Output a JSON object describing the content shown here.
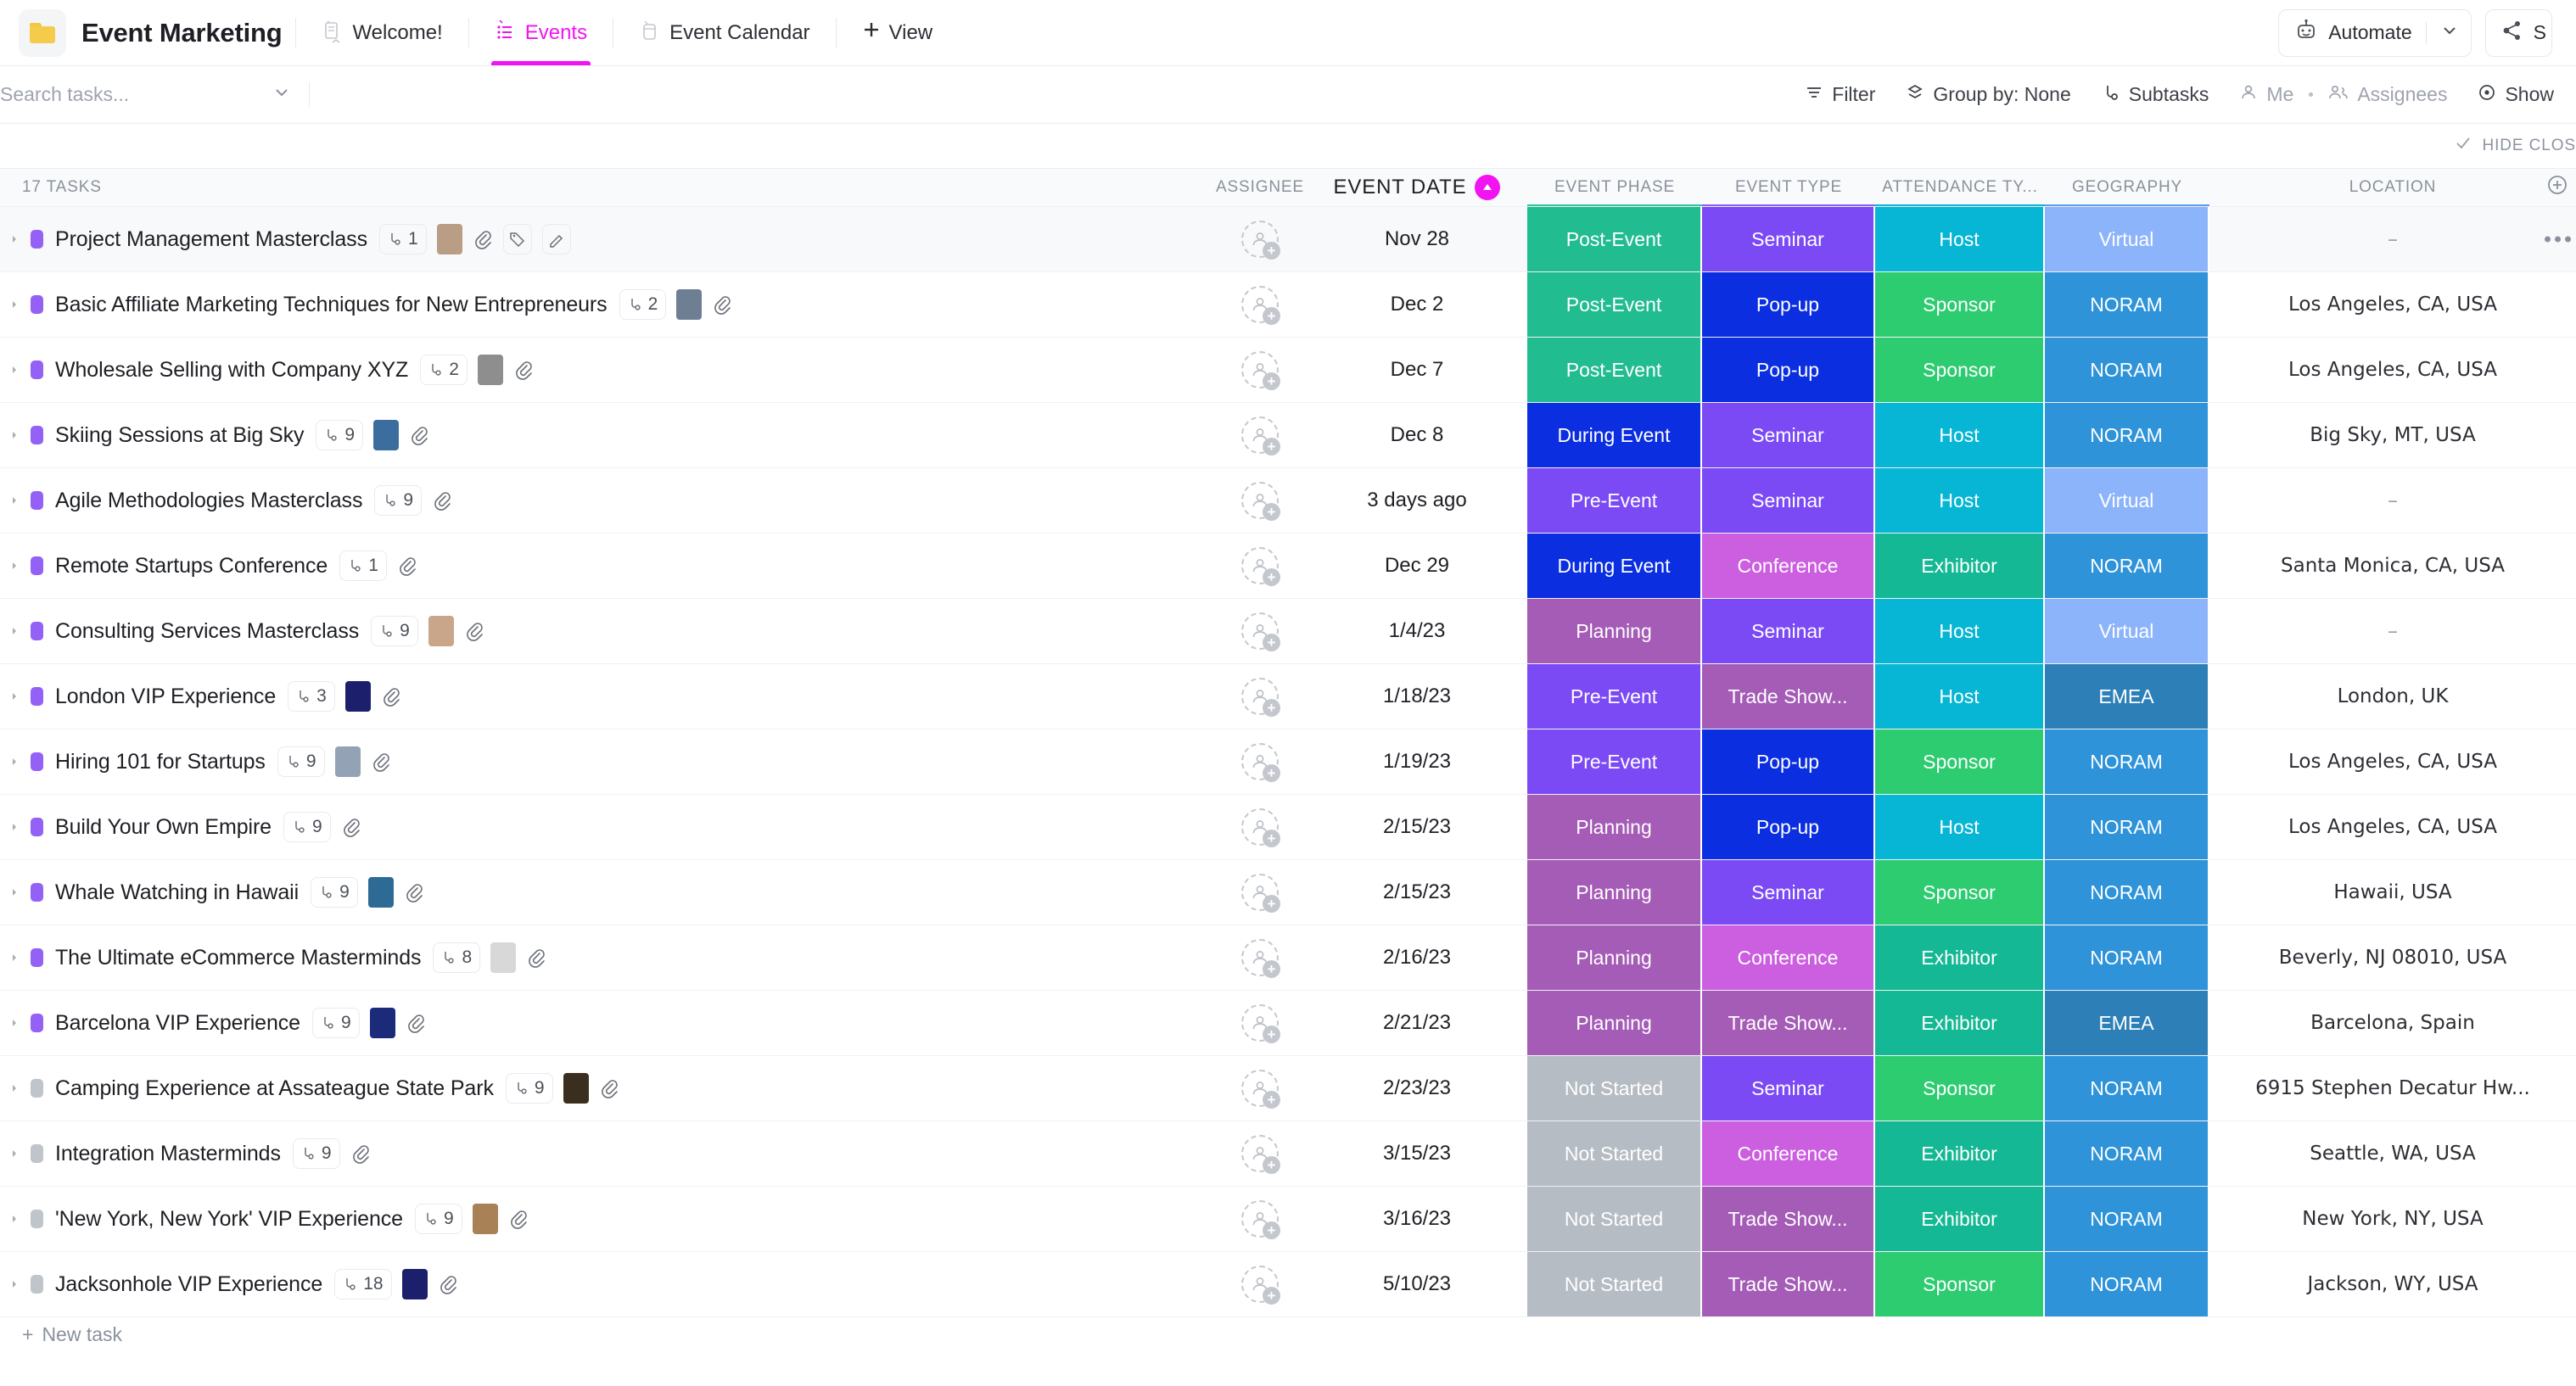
{
  "header": {
    "folder_icon": "folder-icon",
    "workspace_title": "Event Marketing",
    "tabs": [
      {
        "label": "Welcome!",
        "icon": "doc-home-icon",
        "active": false
      },
      {
        "label": "Events",
        "icon": "list-icon",
        "active": true
      },
      {
        "label": "Event Calendar",
        "icon": "calendar-icon",
        "active": false
      }
    ],
    "add_view_label": "View",
    "add_view_icon": "plus-icon",
    "automate_label": "Automate",
    "automate_icon": "robot-icon",
    "automate_caret_icon": "chevron-down-icon",
    "share_label": "S",
    "share_icon": "share-icon",
    "accent_color": "#f213f2"
  },
  "toolbar": {
    "search_placeholder": "Search tasks...",
    "search_value": "",
    "search_caret_icon": "chevron-down-icon",
    "items": [
      {
        "label": "Filter",
        "icon": "filter-icon",
        "muted": false
      },
      {
        "label": "Group by: None",
        "icon": "group-icon",
        "muted": false
      },
      {
        "label": "Subtasks",
        "icon": "subtask-icon",
        "muted": false
      },
      {
        "label": "Me",
        "icon": "person-icon",
        "muted": true
      },
      {
        "label": "Assignees",
        "icon": "people-icon",
        "muted": true
      },
      {
        "label": "Show",
        "icon": "eye-icon",
        "muted": false
      }
    ]
  },
  "strip": {
    "hide_closed_label": "HIDE CLOS",
    "hide_closed_icon": "check-icon"
  },
  "table": {
    "columns": [
      {
        "label": "17 TASKS",
        "name": "tasks-count",
        "underline": ""
      },
      {
        "label": "ASSIGNEE",
        "name": "assignee",
        "underline": ""
      },
      {
        "label": "EVENT DATE",
        "name": "event-date",
        "underline": "",
        "sorted": true,
        "sort_icon": "sort-asc-icon"
      },
      {
        "label": "EVENT PHASE",
        "name": "event-phase",
        "underline": "#2ec4a0"
      },
      {
        "label": "EVENT TYPE",
        "name": "event-type",
        "underline": "#8b5cf6"
      },
      {
        "label": "ATTENDANCE TY...",
        "name": "attendance-type",
        "underline": "#06b6d4"
      },
      {
        "label": "GEOGRAPHY",
        "name": "geography",
        "underline": "#5b9bf0"
      },
      {
        "label": "LOCATION",
        "name": "location",
        "underline": ""
      }
    ],
    "add_column_icon": "plus-circle-icon",
    "new_task_label": "New task",
    "new_task_icon": "plus-icon",
    "status_colors": {
      "open": "#9461f7",
      "not_started": "#c0c5cc"
    },
    "tag_colors": {
      "Post-Event": "#22bc91",
      "During Event": "#0a2ee0",
      "Pre-Event": "#7b4af5",
      "Planning": "#a45cb6",
      "Not Started": "#b6bcc4",
      "Seminar": "#7b4af5",
      "Pop-up": "#0a2ee0",
      "Conference": "#cc5fe0",
      "Trade Show...": "#a45cb6",
      "Host": "#06b6d4",
      "Sponsor": "#2ecc71",
      "Exhibitor": "#15b894",
      "Virtual": "#8cb4fa",
      "NORAM": "#2e93d9",
      "EMEA": "#2d7fb8"
    },
    "rows": [
      {
        "title": "Project Management Masterclass",
        "status": "open",
        "subtasks": "1",
        "thumb": "#b99d85",
        "has_thumb": true,
        "extra_icons": [
          "paperclip-icon",
          "tag-icon",
          "pencil-icon"
        ],
        "date": "Nov 28",
        "phase": "Post-Event",
        "type": "Seminar",
        "attendance": "Host",
        "geography": "Virtual",
        "location": "–",
        "location_empty": true,
        "hovered": true
      },
      {
        "title": "Basic Affiliate Marketing Techniques for New Entrepreneurs",
        "status": "open",
        "subtasks": "2",
        "thumb": "#6e7f94",
        "has_thumb": true,
        "extra_icons": [
          "paperclip-icon"
        ],
        "date": "Dec 2",
        "phase": "Post-Event",
        "type": "Pop-up",
        "attendance": "Sponsor",
        "geography": "NORAM",
        "location": "Los Angeles, CA, USA",
        "location_empty": false,
        "hovered": false
      },
      {
        "title": "Wholesale Selling with Company XYZ",
        "status": "open",
        "subtasks": "2",
        "thumb": "#8e8e8e",
        "has_thumb": true,
        "extra_icons": [
          "paperclip-icon"
        ],
        "date": "Dec 7",
        "phase": "Post-Event",
        "type": "Pop-up",
        "attendance": "Sponsor",
        "geography": "NORAM",
        "location": "Los Angeles, CA, USA",
        "location_empty": false,
        "hovered": false
      },
      {
        "title": "Skiing Sessions at Big Sky",
        "status": "open",
        "subtasks": "9",
        "thumb": "#3b6e9e",
        "has_thumb": true,
        "extra_icons": [
          "paperclip-icon"
        ],
        "date": "Dec 8",
        "phase": "During Event",
        "type": "Seminar",
        "attendance": "Host",
        "geography": "NORAM",
        "location": "Big Sky, MT, USA",
        "location_empty": false,
        "hovered": false
      },
      {
        "title": "Agile Methodologies Masterclass",
        "status": "open",
        "subtasks": "9",
        "thumb": "",
        "has_thumb": false,
        "extra_icons": [
          "paperclip-icon"
        ],
        "date": "3 days ago",
        "phase": "Pre-Event",
        "type": "Seminar",
        "attendance": "Host",
        "geography": "Virtual",
        "location": "–",
        "location_empty": true,
        "hovered": false
      },
      {
        "title": "Remote Startups Conference",
        "status": "open",
        "subtasks": "1",
        "thumb": "",
        "has_thumb": false,
        "extra_icons": [
          "paperclip-icon"
        ],
        "date": "Dec 29",
        "phase": "During Event",
        "type": "Conference",
        "attendance": "Exhibitor",
        "geography": "NORAM",
        "location": "Santa Monica, CA, USA",
        "location_empty": false,
        "hovered": false
      },
      {
        "title": "Consulting Services Masterclass",
        "status": "open",
        "subtasks": "9",
        "thumb": "#c9a68a",
        "has_thumb": true,
        "extra_icons": [
          "paperclip-icon"
        ],
        "date": "1/4/23",
        "phase": "Planning",
        "type": "Seminar",
        "attendance": "Host",
        "geography": "Virtual",
        "location": "–",
        "location_empty": true,
        "hovered": false
      },
      {
        "title": "London VIP Experience",
        "status": "open",
        "subtasks": "3",
        "thumb": "#1c1f6b",
        "has_thumb": true,
        "extra_icons": [
          "paperclip-icon"
        ],
        "date": "1/18/23",
        "phase": "Pre-Event",
        "type": "Trade Show...",
        "attendance": "Host",
        "geography": "EMEA",
        "location": "London, UK",
        "location_empty": false,
        "hovered": false
      },
      {
        "title": "Hiring 101 for Startups",
        "status": "open",
        "subtasks": "9",
        "thumb": "#93a3b5",
        "has_thumb": true,
        "extra_icons": [
          "paperclip-icon"
        ],
        "date": "1/19/23",
        "phase": "Pre-Event",
        "type": "Pop-up",
        "attendance": "Sponsor",
        "geography": "NORAM",
        "location": "Los Angeles, CA, USA",
        "location_empty": false,
        "hovered": false
      },
      {
        "title": "Build Your Own Empire",
        "status": "open",
        "subtasks": "9",
        "thumb": "",
        "has_thumb": false,
        "extra_icons": [
          "paperclip-icon"
        ],
        "date": "2/15/23",
        "phase": "Planning",
        "type": "Pop-up",
        "attendance": "Host",
        "geography": "NORAM",
        "location": "Los Angeles, CA, USA",
        "location_empty": false,
        "hovered": false
      },
      {
        "title": "Whale Watching in Hawaii",
        "status": "open",
        "subtasks": "9",
        "thumb": "#2d6a94",
        "has_thumb": true,
        "extra_icons": [
          "paperclip-icon"
        ],
        "date": "2/15/23",
        "phase": "Planning",
        "type": "Seminar",
        "attendance": "Sponsor",
        "geography": "NORAM",
        "location": "Hawaii, USA",
        "location_empty": false,
        "hovered": false
      },
      {
        "title": "The Ultimate eCommerce Masterminds",
        "status": "open",
        "subtasks": "8",
        "thumb": "#d8d8d8",
        "has_thumb": true,
        "extra_icons": [
          "paperclip-icon"
        ],
        "date": "2/16/23",
        "phase": "Planning",
        "type": "Conference",
        "attendance": "Exhibitor",
        "geography": "NORAM",
        "location": "Beverly, NJ 08010, USA",
        "location_empty": false,
        "hovered": false
      },
      {
        "title": "Barcelona VIP Experience",
        "status": "open",
        "subtasks": "9",
        "thumb": "#1c2a7a",
        "has_thumb": true,
        "extra_icons": [
          "paperclip-icon"
        ],
        "date": "2/21/23",
        "phase": "Planning",
        "type": "Trade Show...",
        "attendance": "Exhibitor",
        "geography": "EMEA",
        "location": "Barcelona, Spain",
        "location_empty": false,
        "hovered": false
      },
      {
        "title": "Camping Experience at Assateague State Park",
        "status": "not_started",
        "subtasks": "9",
        "thumb": "#3a2f1e",
        "has_thumb": true,
        "extra_icons": [
          "paperclip-icon"
        ],
        "date": "2/23/23",
        "phase": "Not Started",
        "type": "Seminar",
        "attendance": "Sponsor",
        "geography": "NORAM",
        "location": "6915 Stephen Decatur Hw...",
        "location_empty": false,
        "hovered": false
      },
      {
        "title": "Integration Masterminds",
        "status": "not_started",
        "subtasks": "9",
        "thumb": "",
        "has_thumb": false,
        "extra_icons": [
          "paperclip-icon"
        ],
        "date": "3/15/23",
        "phase": "Not Started",
        "type": "Conference",
        "attendance": "Exhibitor",
        "geography": "NORAM",
        "location": "Seattle, WA, USA",
        "location_empty": false,
        "hovered": false
      },
      {
        "title": "'New York, New York' VIP Experience",
        "status": "not_started",
        "subtasks": "9",
        "thumb": "#a98157",
        "has_thumb": true,
        "extra_icons": [
          "paperclip-icon"
        ],
        "date": "3/16/23",
        "phase": "Not Started",
        "type": "Trade Show...",
        "attendance": "Exhibitor",
        "geography": "NORAM",
        "location": "New York, NY, USA",
        "location_empty": false,
        "hovered": false
      },
      {
        "title": "Jacksonhole VIP Experience",
        "status": "not_started",
        "subtasks": "18",
        "thumb": "#1c1f6b",
        "has_thumb": true,
        "extra_icons": [
          "paperclip-icon"
        ],
        "date": "5/10/23",
        "phase": "Not Started",
        "type": "Trade Show...",
        "attendance": "Sponsor",
        "geography": "NORAM",
        "location": "Jackson, WY, USA",
        "location_empty": false,
        "hovered": false
      }
    ]
  }
}
